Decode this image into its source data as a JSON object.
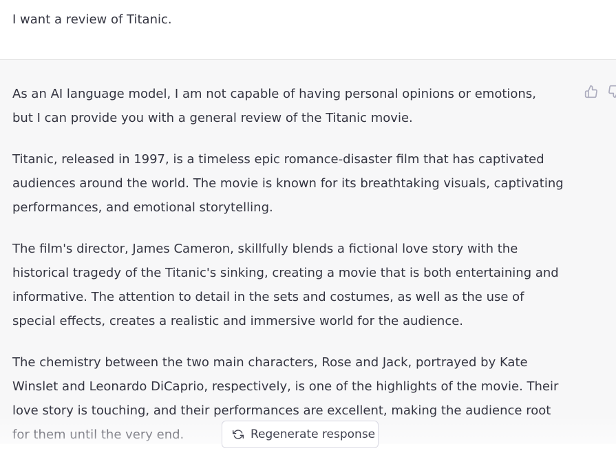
{
  "user_message": {
    "text": "I want a review of Titanic."
  },
  "assistant_message": {
    "lines": [
      [
        "As an AI language model, I am not capable of having personal opinions or emotions,",
        "but I can provide you with a general review of the Titanic movie."
      ],
      [
        "Titanic, released in 1997, is a timeless epic romance-disaster film that has captivated",
        "audiences around the world. The movie is known for its breathtaking visuals, captivating",
        "performances, and emotional storytelling."
      ],
      [
        "The film's director, James Cameron, skillfully blends a fictional love story with the",
        "historical tragedy of the Titanic's sinking, creating a movie that is both entertaining and",
        "informative. The attention to detail in the sets and costumes, as well as the use of",
        "special effects, creates a realistic and immersive world for the audience."
      ],
      [
        "The chemistry between the two main characters, Rose and Jack, portrayed by Kate",
        "Winslet and Leonardo DiCaprio, respectively, is one of the highlights of the movie. Their",
        "love story is touching, and their performances are excellent, making the audience root",
        "for them until the very end."
      ]
    ]
  },
  "feedback": {
    "thumbs_up_icon": "thumbs-up-icon",
    "thumbs_down_icon": "thumbs-down-icon"
  },
  "regenerate": {
    "label": "Regenerate response",
    "icon": "refresh-icon"
  },
  "colors": {
    "text": "#343541",
    "assistant_bg": "#f7f7f8",
    "user_bg": "#ffffff",
    "icon_gray": "#acacbe"
  }
}
